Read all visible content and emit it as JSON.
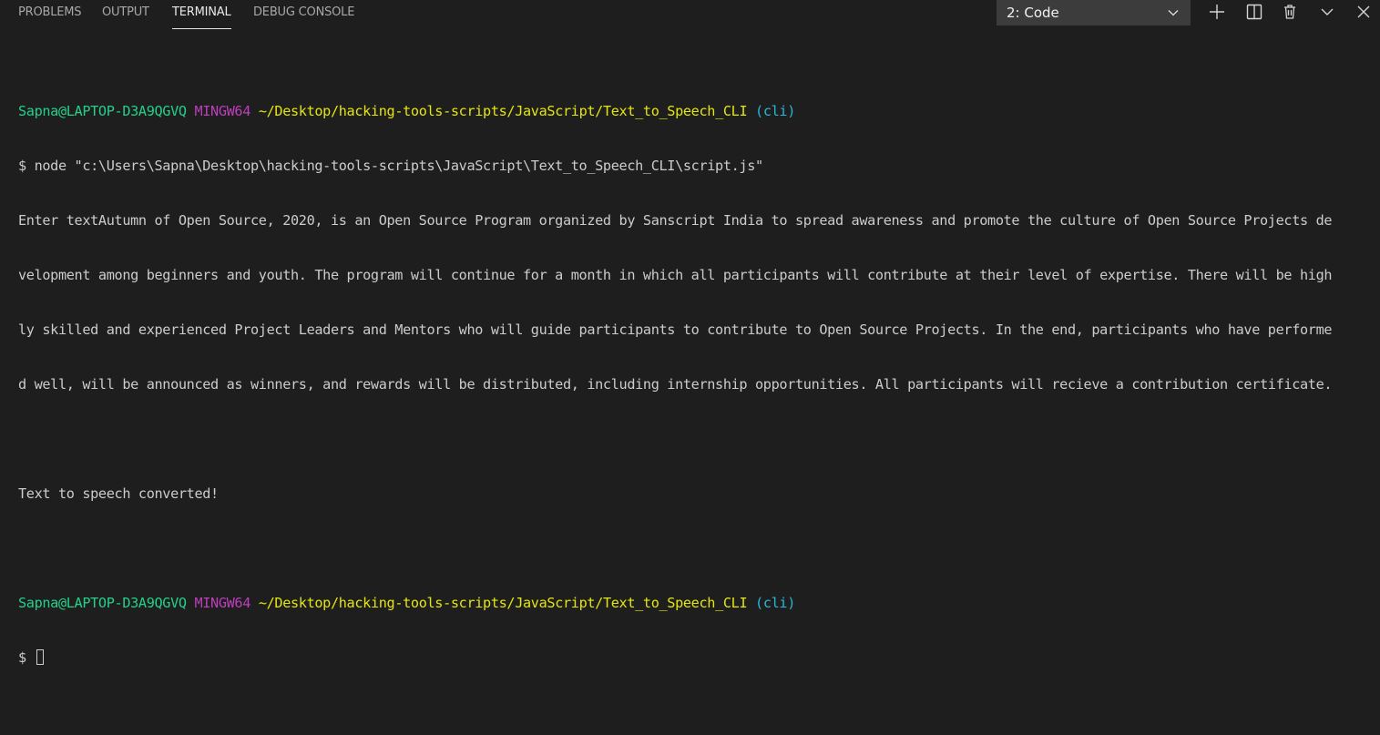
{
  "tabs": {
    "problems": "PROBLEMS",
    "output": "OUTPUT",
    "terminal": "TERMINAL",
    "debug_console": "DEBUG CONSOLE",
    "active": "TERMINAL"
  },
  "terminal_selector": {
    "selected": "2: Code"
  },
  "actions": {
    "add": "plus-icon",
    "split": "split-icon",
    "kill": "trash-icon",
    "maximize": "chevron-down-icon",
    "close": "close-icon"
  },
  "terminal": {
    "prompt1": {
      "user_host": "Sapna@LAPTOP-D3A9QGVQ",
      "system": "MINGW64",
      "path": "~/Desktop/hacking-tools-scripts/JavaScript/Text_to_Speech_CLI",
      "branch": "(cli)"
    },
    "command": "$ node \"c:\\Users\\Sapna\\Desktop\\hacking-tools-scripts\\JavaScript\\Text_to_Speech_CLI\\script.js\"",
    "output_lines": [
      "Enter textAutumn of Open Source, 2020, is an Open Source Program organized by Sanscript India to spread awareness and promote the culture of Open Source Projects de",
      "velopment among beginners and youth. The program will continue for a month in which all participants will contribute at their level of expertise. There will be high",
      "ly skilled and experienced Project Leaders and Mentors who will guide participants to contribute to Open Source Projects. In the end, participants who have performe",
      "d well, will be announced as winners, and rewards will be distributed, including internship opportunities. All participants will recieve a contribution certificate."
    ],
    "converted_message": "Text to speech converted!",
    "prompt2": {
      "user_host": "Sapna@LAPTOP-D3A9QGVQ",
      "system": "MINGW64",
      "path": "~/Desktop/hacking-tools-scripts/JavaScript/Text_to_Speech_CLI",
      "branch": "(cli)"
    },
    "final_prompt": "$ "
  },
  "colors": {
    "background": "#1e1e1e",
    "green": "#23d18b",
    "magenta": "#bc3fbc",
    "yellow": "#e5e510",
    "cyan": "#29b8db",
    "text": "#cccccc"
  }
}
